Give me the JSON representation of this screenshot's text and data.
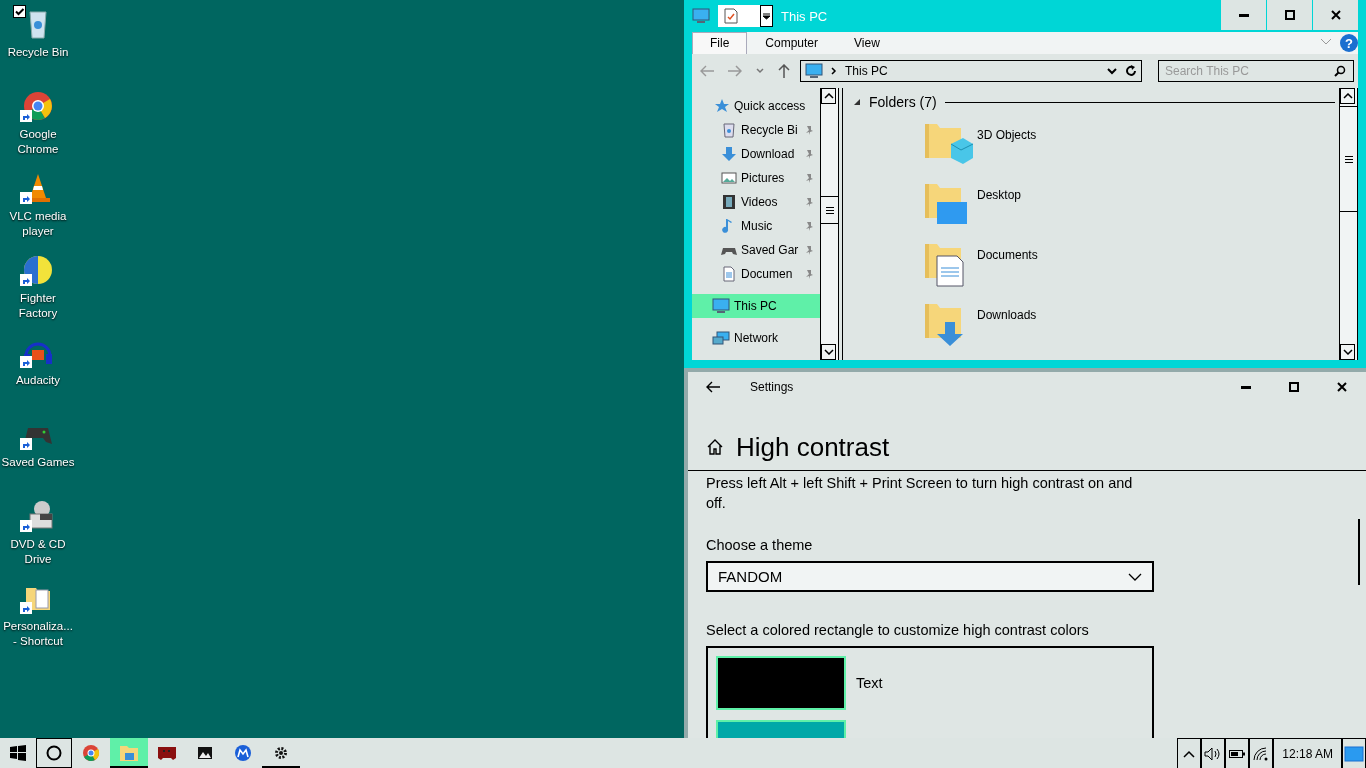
{
  "desktop_icons": [
    {
      "label": "Recycle Bin",
      "kind": "recycle",
      "selected": true,
      "shortcut": false
    },
    {
      "label": "Google Chrome",
      "kind": "chrome",
      "selected": false,
      "shortcut": true
    },
    {
      "label": "VLC media player",
      "kind": "cone",
      "selected": false,
      "shortcut": true
    },
    {
      "label": "Fighter Factory",
      "kind": "ball",
      "selected": false,
      "shortcut": true
    },
    {
      "label": "Audacity",
      "kind": "headphones",
      "selected": false,
      "shortcut": true
    },
    {
      "label": "Saved Games",
      "kind": "gamepad",
      "selected": false,
      "shortcut": true
    },
    {
      "label": "DVD & CD Drive",
      "kind": "dvd",
      "selected": false,
      "shortcut": true
    },
    {
      "label": "Personaliza... - Shortcut",
      "kind": "folder",
      "selected": false,
      "shortcut": true
    }
  ],
  "explorer": {
    "title": "This PC",
    "ribbon_tabs": [
      {
        "label": "File",
        "selected": true
      },
      {
        "label": "Computer",
        "selected": false
      },
      {
        "label": "View",
        "selected": false
      }
    ],
    "help_glyph": "?",
    "address": "This PC",
    "search": {
      "placeholder": "Search This PC"
    },
    "nav": [
      {
        "label": "Quick access",
        "kind": "star",
        "selected": false,
        "pinned": false,
        "children": [
          {
            "label": "Recycle Bi",
            "kind": "recycle",
            "selected": false,
            "pinned": true
          },
          {
            "label": "Download",
            "kind": "download",
            "selected": false,
            "pinned": true
          },
          {
            "label": "Pictures",
            "kind": "pictures",
            "selected": false,
            "pinned": true
          },
          {
            "label": "Videos",
            "kind": "videos",
            "selected": false,
            "pinned": true
          },
          {
            "label": "Music",
            "kind": "music",
            "selected": false,
            "pinned": true
          },
          {
            "label": "Saved Gar",
            "kind": "gamepad",
            "selected": false,
            "pinned": true
          },
          {
            "label": "Documen",
            "kind": "document",
            "selected": false,
            "pinned": true
          }
        ]
      },
      {
        "label": "This PC",
        "kind": "pc",
        "selected": true,
        "pinned": false
      },
      {
        "label": "Network",
        "kind": "network",
        "selected": false,
        "pinned": false
      }
    ],
    "group_heading": "Folders (7)",
    "folders": [
      {
        "name": "3D Objects",
        "kind": "cube"
      },
      {
        "name": "Desktop",
        "kind": "screen"
      },
      {
        "name": "Documents",
        "kind": "document"
      },
      {
        "name": "Downloads",
        "kind": "download"
      }
    ]
  },
  "settings": {
    "title": "Settings",
    "heading": "High contrast",
    "description": "Press left Alt + left Shift + Print Screen to turn high contrast on and off.",
    "theme_label": "Choose a theme",
    "theme_value": "FANDOM",
    "colors_label": "Select a colored rectangle to customize high contrast colors",
    "swatches": [
      {
        "label": "Text",
        "color": "#000000"
      },
      {
        "color": "#00a8a8"
      }
    ]
  },
  "taskbar": {
    "apps": [
      {
        "kind": "chrome",
        "selected": false,
        "running": false
      },
      {
        "kind": "folder",
        "selected": true,
        "running": true
      },
      {
        "kind": "game",
        "selected": false,
        "running": false
      },
      {
        "kind": "photo",
        "selected": false,
        "running": false
      },
      {
        "kind": "m-app",
        "selected": false,
        "running": false
      },
      {
        "kind": "gear",
        "selected": false,
        "running": true
      }
    ],
    "clock": "12:18 AM"
  }
}
